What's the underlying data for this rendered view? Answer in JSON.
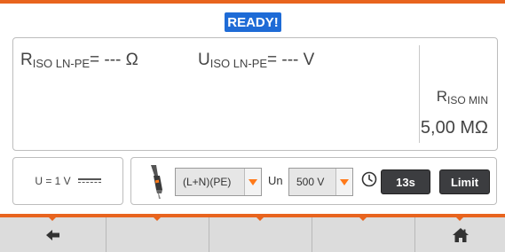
{
  "status": {
    "ready_label": "READY!"
  },
  "result": {
    "riso_main": "R",
    "riso_sub": "ISO LN-PE",
    "riso_value": "= --- Ω",
    "uiso_main": "U",
    "uiso_sub": "ISO LN-PE",
    "uiso_value": "= --- V",
    "riso_min_main": "R",
    "riso_min_sub": "ISO MIN",
    "riso_min_value": "5,00 MΩ"
  },
  "test_voltage": {
    "label": "U = 1 V"
  },
  "settings": {
    "config_selected": "(L+N)(PE)",
    "un_label": "Un",
    "voltage_selected": "500 V",
    "time_label": "13s",
    "limit_label": "Limit"
  },
  "nav": {
    "back_icon": "arrow-left-icon",
    "home_icon": "home-icon"
  },
  "colors": {
    "accent": "#e8641e",
    "ready_bg": "#1e6bd6",
    "button_dark": "#3c3d40",
    "nav_bg": "#dcdcdc"
  }
}
